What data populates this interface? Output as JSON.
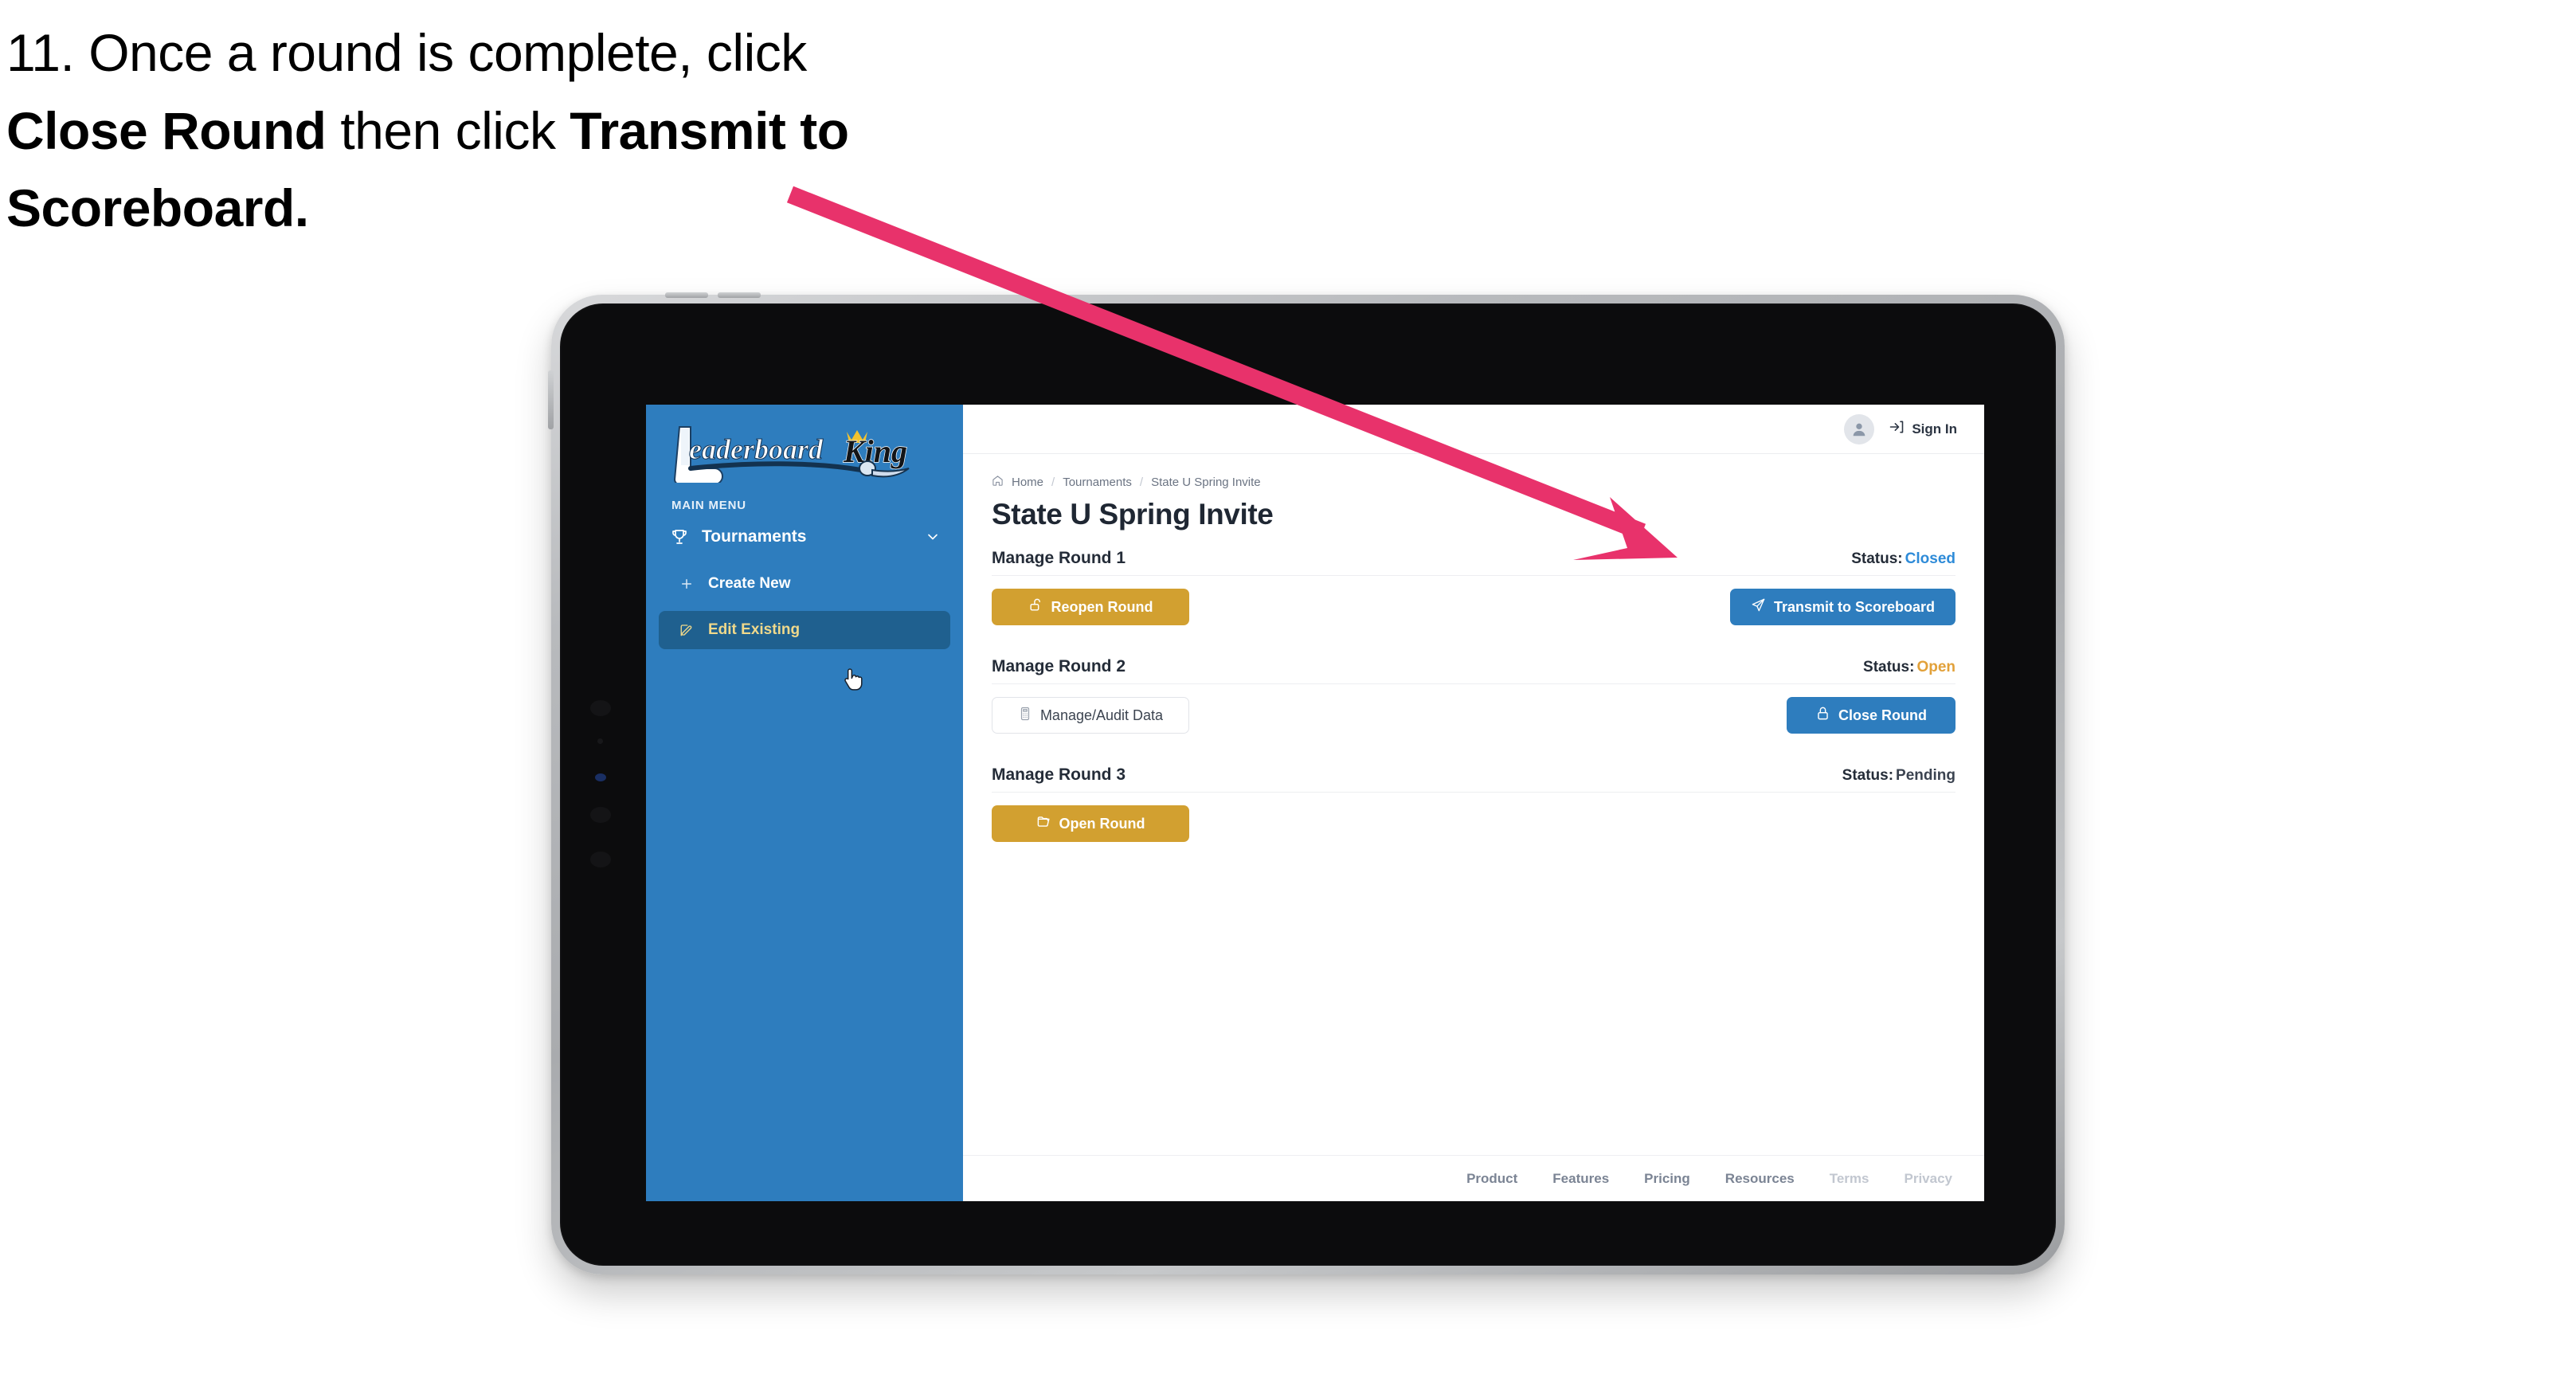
{
  "caption": {
    "part1": "11. Once a round is complete, click ",
    "bold1": "Close Round",
    "part2": " then click ",
    "bold2": "Transmit to Scoreboard."
  },
  "colors": {
    "brand_blue": "#2E7DBE",
    "gold": "#D2A030",
    "status_closed": "#2E8BD8",
    "status_open": "#E2A13A",
    "status_pending": "#3b4350",
    "annotation_pink": "#E8326B",
    "sidebar_active_bg": "#1F608F",
    "sidebar_active_text": "#F0D98B"
  },
  "sidebar": {
    "logo": {
      "word1": "Leaderboard",
      "word2": "King"
    },
    "section_label": "MAIN MENU",
    "nav": {
      "label": "Tournaments",
      "icon": "trophy-icon",
      "chevron": "chevron-down-icon"
    },
    "items": [
      {
        "label": "Create New",
        "icon": "plus-icon",
        "active": false
      },
      {
        "label": "Edit Existing",
        "icon": "pencil-square-icon",
        "active": true
      }
    ]
  },
  "topbar": {
    "avatar_icon": "user-avatar-icon",
    "signin_icon": "login-arrow-icon",
    "signin_label": "Sign In"
  },
  "breadcrumb": {
    "home_icon": "home-icon",
    "items": [
      "Home",
      "Tournaments",
      "State U Spring Invite"
    ],
    "separator": "/"
  },
  "page": {
    "title": "State U Spring Invite"
  },
  "rounds": [
    {
      "name": "Manage Round 1",
      "status_label": "Status:",
      "status_value": "Closed",
      "status_class": "sv-closed",
      "left_button": {
        "label": "Reopen Round",
        "icon": "unlock-icon",
        "style": "btn-gold"
      },
      "right_button": {
        "label": "Transmit to Scoreboard",
        "icon": "paper-plane-icon",
        "style": "btn-blue"
      }
    },
    {
      "name": "Manage Round 2",
      "status_label": "Status:",
      "status_value": "Open",
      "status_class": "sv-open",
      "left_button": {
        "label": "Manage/Audit Data",
        "icon": "calculator-icon",
        "style": "btn-ghost"
      },
      "right_button": {
        "label": "Close Round",
        "icon": "lock-icon",
        "style": "btn-blue"
      }
    },
    {
      "name": "Manage Round 3",
      "status_label": "Status:",
      "status_value": "Pending",
      "status_class": "sv-pending",
      "left_button": {
        "label": "Open Round",
        "icon": "open-folder-icon",
        "style": "btn-gold"
      },
      "right_button": null
    }
  ],
  "footer": {
    "links": [
      {
        "label": "Product",
        "dim": false
      },
      {
        "label": "Features",
        "dim": false
      },
      {
        "label": "Pricing",
        "dim": false
      },
      {
        "label": "Resources",
        "dim": false
      },
      {
        "label": "Terms",
        "dim": true
      },
      {
        "label": "Privacy",
        "dim": true
      }
    ]
  },
  "cursor": {
    "icon": "pointing-hand-cursor"
  },
  "annotation": {
    "icon": "arrow-annotation"
  }
}
